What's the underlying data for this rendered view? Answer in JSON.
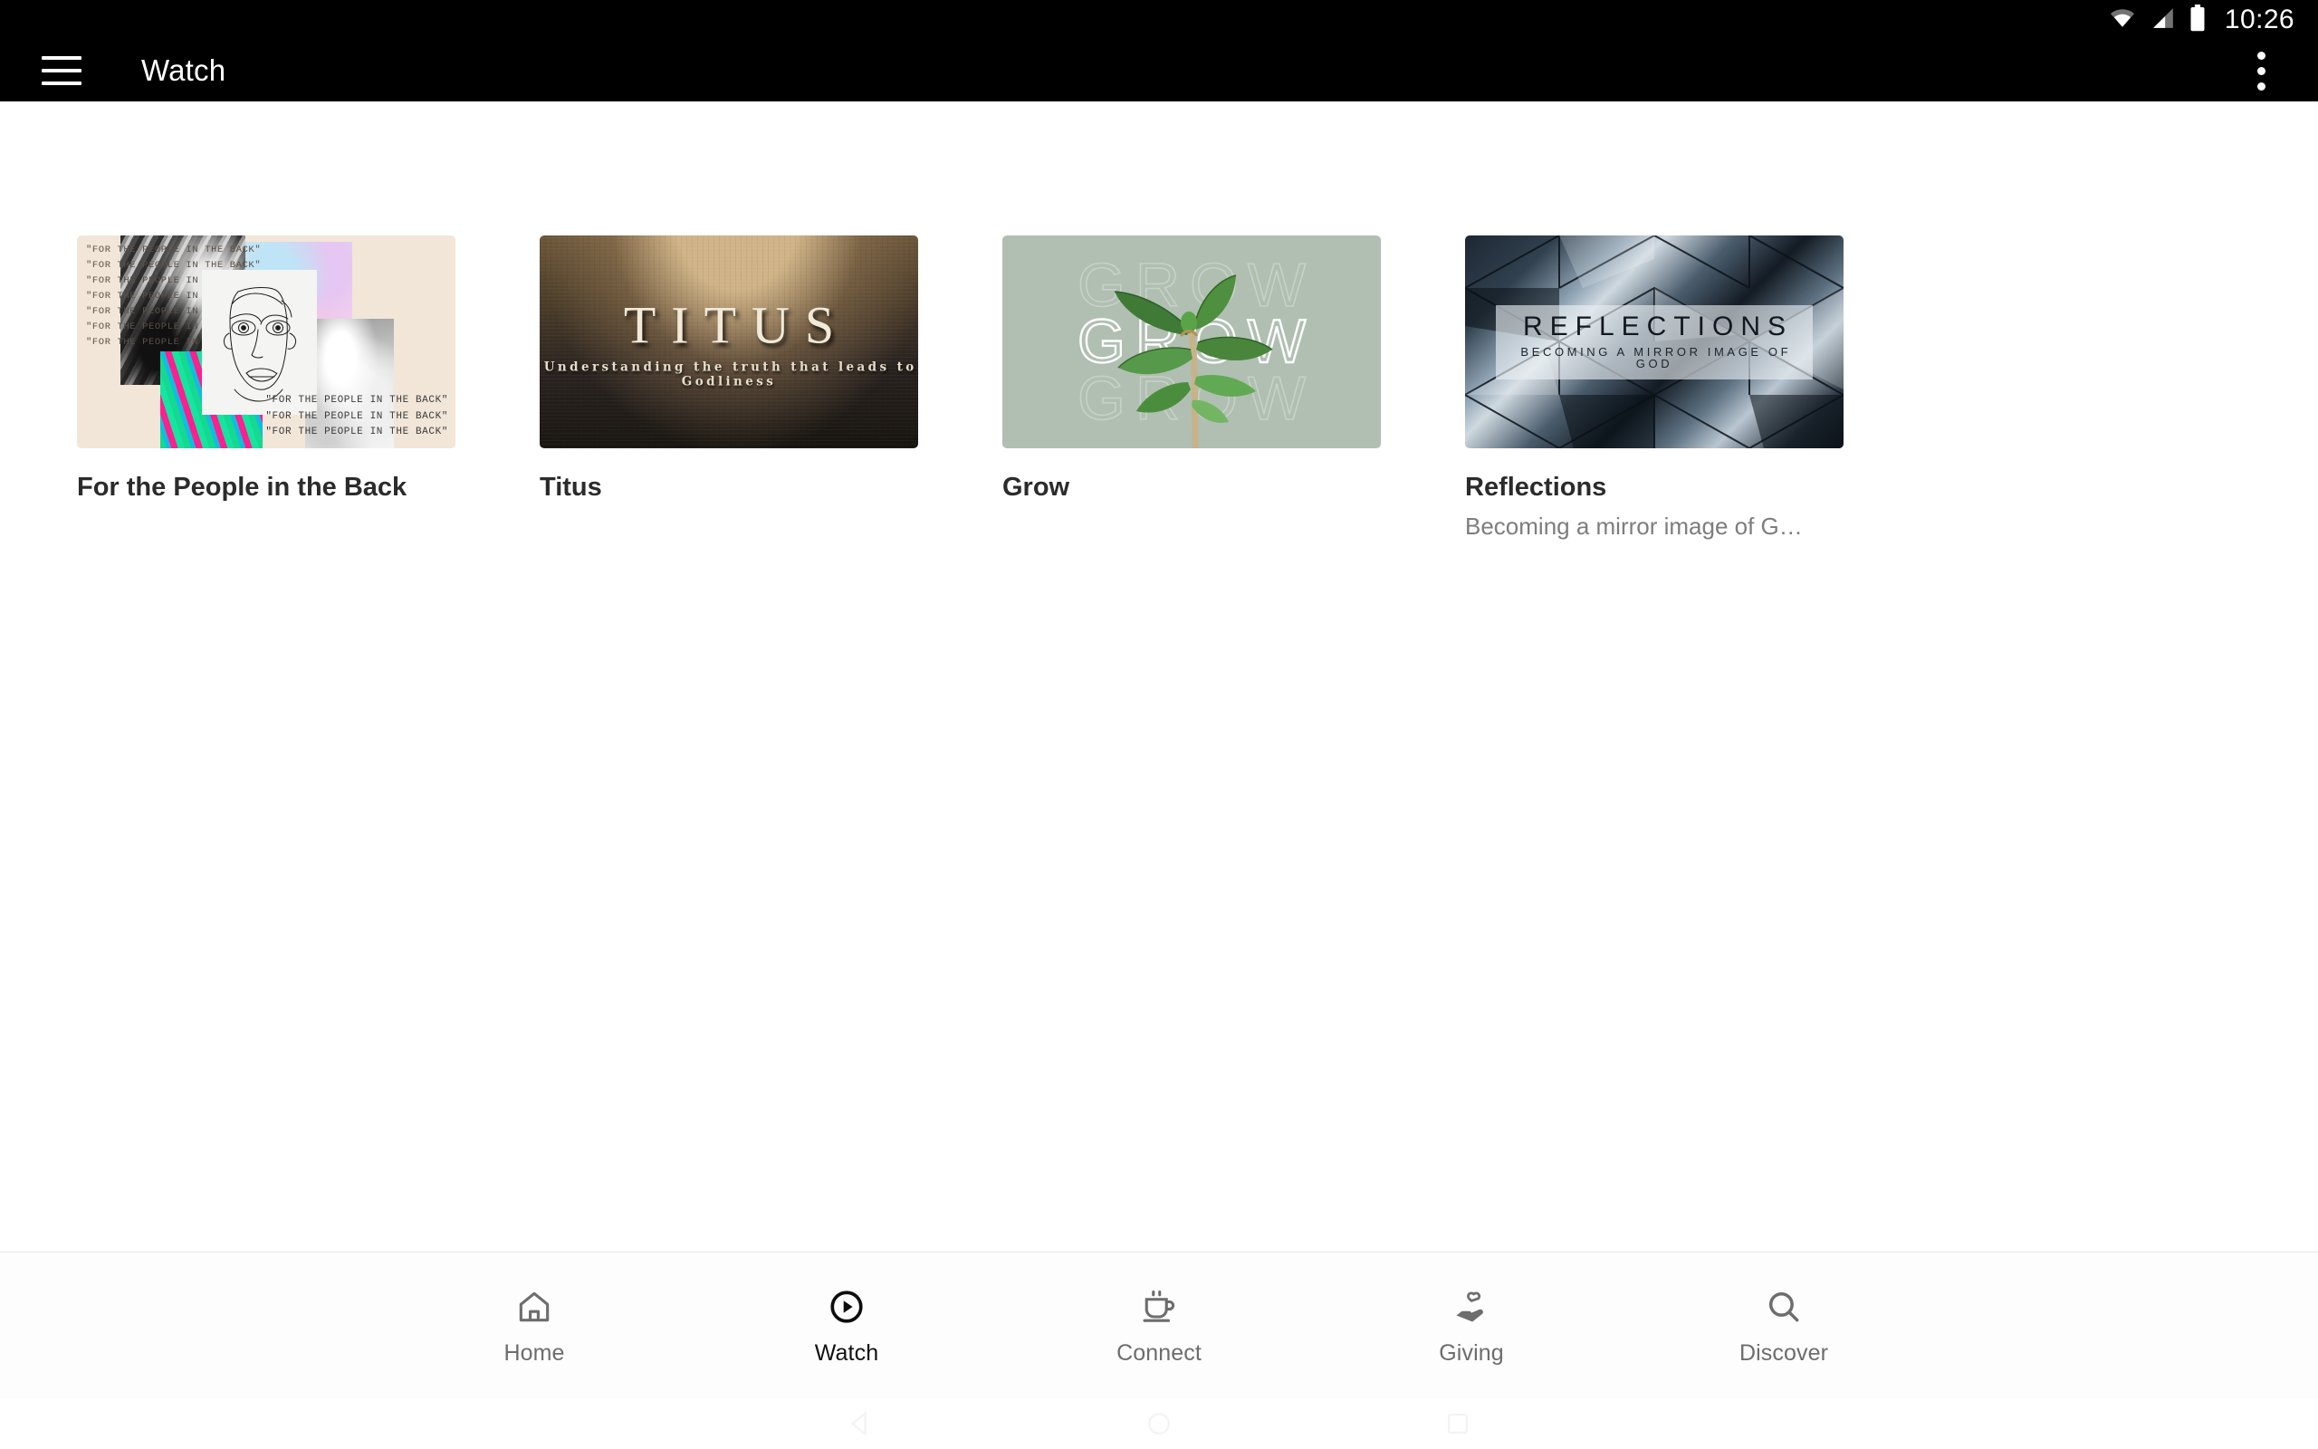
{
  "status_bar": {
    "time": "10:26",
    "icons": [
      "wifi-icon",
      "cellular-signal-icon",
      "battery-icon"
    ]
  },
  "app_bar": {
    "menu_icon": "hamburger-menu-icon",
    "title": "Watch",
    "overflow_icon": "overflow-menu-icon"
  },
  "colors": {
    "app_bar_bg": "#000000",
    "page_bg": "#ffffff",
    "title_text": "#2b2b2b",
    "subtitle_text": "#7d7d7d",
    "nav_inactive": "#6d6d6d",
    "nav_active": "#111111",
    "grow_card_bg": "#b0bfb2",
    "collage_card_bg": "#f2e6d8"
  },
  "series_list": [
    {
      "title": "For the People in the Back",
      "subtitle": "",
      "artwork_name": "for-the-people-in-the-back-artwork",
      "artwork_text": "\"FOR THE PEOPLE IN THE BACK\""
    },
    {
      "title": "Titus",
      "subtitle": "",
      "artwork_name": "titus-artwork",
      "artwork_title": "TITUS",
      "artwork_subtitle": "Understanding the truth that leads to Godliness"
    },
    {
      "title": "Grow",
      "subtitle": "",
      "artwork_name": "grow-artwork",
      "artwork_title": "GROW"
    },
    {
      "title": "Reflections",
      "subtitle": "Becoming a mirror image of G…",
      "artwork_name": "reflections-artwork",
      "artwork_title": "REFLECTIONS",
      "artwork_subtitle": "BECOMING A MIRROR IMAGE OF GOD"
    }
  ],
  "bottom_nav": {
    "items": [
      {
        "label": "Home",
        "icon": "home-icon",
        "active": false
      },
      {
        "label": "Watch",
        "icon": "play-circle-icon",
        "active": true
      },
      {
        "label": "Connect",
        "icon": "coffee-cup-icon",
        "active": false
      },
      {
        "label": "Giving",
        "icon": "hand-heart-icon",
        "active": false
      },
      {
        "label": "Discover",
        "icon": "search-icon",
        "active": false
      }
    ]
  },
  "system_nav": {
    "back": "back-triangle-icon",
    "home": "home-circle-icon",
    "recents": "recents-square-icon"
  }
}
